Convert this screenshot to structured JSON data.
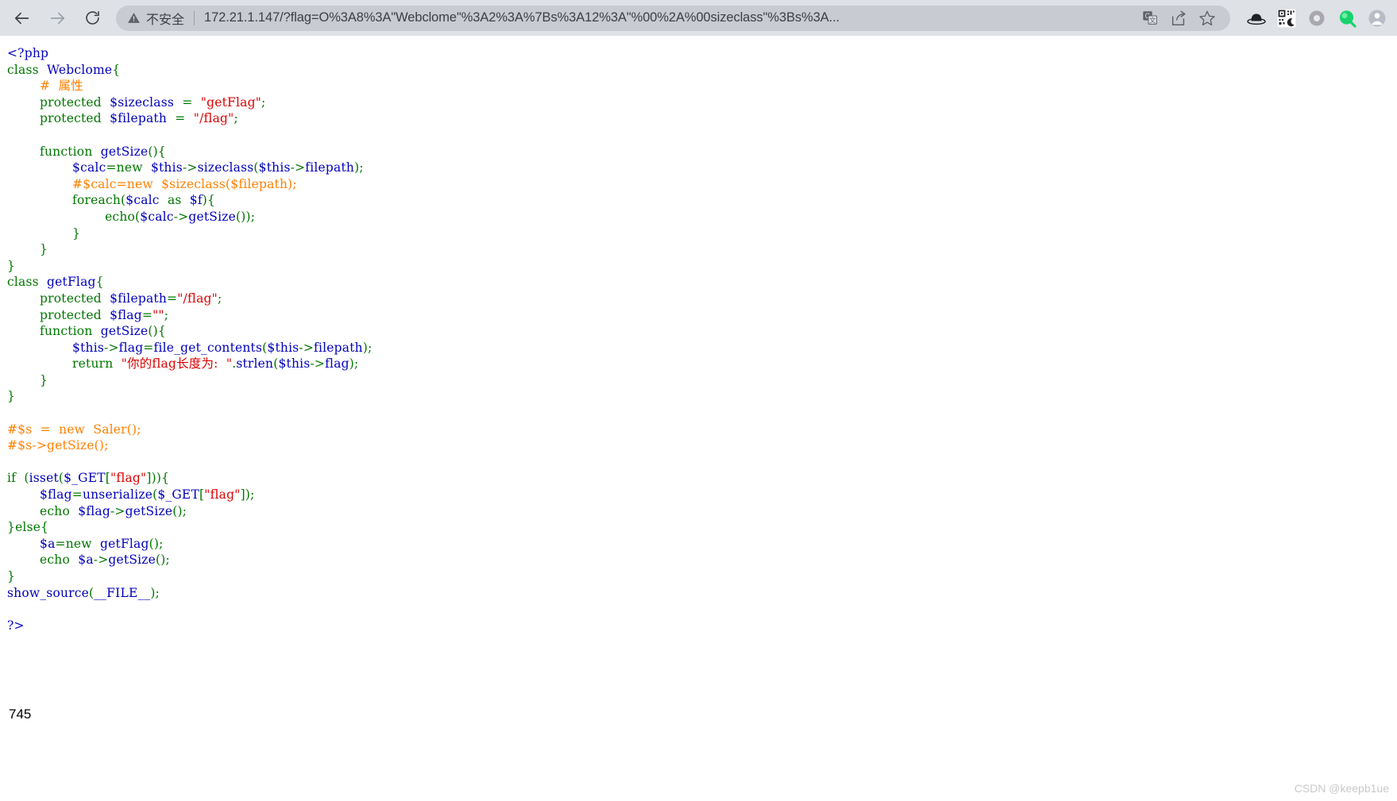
{
  "browser": {
    "back_label": "Back",
    "forward_label": "Forward",
    "reload_label": "Reload",
    "security_label": "不安全",
    "url": "172.21.1.147/?flag=O%3A8%3A\"Webclome\"%3A2%3A%7Bs%3A12%3A\"%00%2A%00sizeclass\"%3Bs%3A...",
    "omnibox_icons": [
      {
        "name": "translate-icon",
        "label": "Translate this page"
      },
      {
        "name": "share-icon",
        "label": "Share this page"
      },
      {
        "name": "bookmark-star-icon",
        "label": "Bookmark this tab"
      }
    ],
    "extension_icons": [
      {
        "name": "hat-extension-icon",
        "label": "Hat"
      },
      {
        "name": "qr-code-icon",
        "label": "QR code"
      },
      {
        "name": "ring-extension-icon",
        "label": "Extension"
      },
      {
        "name": "green-search-icon",
        "label": "Search extension"
      },
      {
        "name": "profile-avatar-icon",
        "label": "Profile"
      }
    ]
  },
  "page": {
    "php_output": "745",
    "watermark": "CSDN @keepb1ue",
    "source_lines": [
      [
        {
          "t": "<?php",
          "c": "c-default"
        }
      ],
      [
        {
          "t": "class  ",
          "c": "c-kw"
        },
        {
          "t": "Webclome",
          "c": "c-default"
        },
        {
          "t": "{",
          "c": "c-kw"
        }
      ],
      [
        {
          "t": "        ",
          "c": "c-default"
        },
        {
          "t": "#  属性",
          "c": "c-com"
        }
      ],
      [
        {
          "t": "        ",
          "c": "c-default"
        },
        {
          "t": "protected  ",
          "c": "c-kw"
        },
        {
          "t": "$sizeclass",
          "c": "c-var"
        },
        {
          "t": "  =  ",
          "c": "c-kw"
        },
        {
          "t": "\"getFlag\"",
          "c": "c-str"
        },
        {
          "t": ";",
          "c": "c-kw"
        }
      ],
      [
        {
          "t": "        ",
          "c": "c-default"
        },
        {
          "t": "protected  ",
          "c": "c-kw"
        },
        {
          "t": "$filepath",
          "c": "c-var"
        },
        {
          "t": "  =  ",
          "c": "c-kw"
        },
        {
          "t": "\"/flag\"",
          "c": "c-str"
        },
        {
          "t": ";",
          "c": "c-kw"
        }
      ],
      [
        {
          "t": "",
          "c": "c-default"
        }
      ],
      [
        {
          "t": "        ",
          "c": "c-default"
        },
        {
          "t": "function  ",
          "c": "c-kw"
        },
        {
          "t": "getSize",
          "c": "c-default"
        },
        {
          "t": "(){",
          "c": "c-kw"
        }
      ],
      [
        {
          "t": "                ",
          "c": "c-default"
        },
        {
          "t": "$calc",
          "c": "c-var"
        },
        {
          "t": "=",
          "c": "c-kw"
        },
        {
          "t": "new  ",
          "c": "c-kw"
        },
        {
          "t": "$this",
          "c": "c-var"
        },
        {
          "t": "->",
          "c": "c-kw"
        },
        {
          "t": "sizeclass",
          "c": "c-default"
        },
        {
          "t": "(",
          "c": "c-kw"
        },
        {
          "t": "$this",
          "c": "c-var"
        },
        {
          "t": "->",
          "c": "c-kw"
        },
        {
          "t": "filepath",
          "c": "c-default"
        },
        {
          "t": ");",
          "c": "c-kw"
        }
      ],
      [
        {
          "t": "                ",
          "c": "c-default"
        },
        {
          "t": "#$calc=new  $sizeclass($filepath);",
          "c": "c-com"
        }
      ],
      [
        {
          "t": "                ",
          "c": "c-default"
        },
        {
          "t": "foreach",
          "c": "c-kw"
        },
        {
          "t": "(",
          "c": "c-kw"
        },
        {
          "t": "$calc",
          "c": "c-var"
        },
        {
          "t": "  as  ",
          "c": "c-kw"
        },
        {
          "t": "$f",
          "c": "c-var"
        },
        {
          "t": "){",
          "c": "c-kw"
        }
      ],
      [
        {
          "t": "                        ",
          "c": "c-default"
        },
        {
          "t": "echo",
          "c": "c-kw"
        },
        {
          "t": "(",
          "c": "c-kw"
        },
        {
          "t": "$calc",
          "c": "c-var"
        },
        {
          "t": "->",
          "c": "c-kw"
        },
        {
          "t": "getSize",
          "c": "c-default"
        },
        {
          "t": "());",
          "c": "c-kw"
        }
      ],
      [
        {
          "t": "                ",
          "c": "c-default"
        },
        {
          "t": "}",
          "c": "c-kw"
        }
      ],
      [
        {
          "t": "        ",
          "c": "c-default"
        },
        {
          "t": "}",
          "c": "c-kw"
        }
      ],
      [
        {
          "t": "}",
          "c": "c-kw"
        }
      ],
      [
        {
          "t": "class  ",
          "c": "c-kw"
        },
        {
          "t": "getFlag",
          "c": "c-default"
        },
        {
          "t": "{",
          "c": "c-kw"
        }
      ],
      [
        {
          "t": "        ",
          "c": "c-default"
        },
        {
          "t": "protected  ",
          "c": "c-kw"
        },
        {
          "t": "$filepath",
          "c": "c-var"
        },
        {
          "t": "=",
          "c": "c-kw"
        },
        {
          "t": "\"/flag\"",
          "c": "c-str"
        },
        {
          "t": ";",
          "c": "c-kw"
        }
      ],
      [
        {
          "t": "        ",
          "c": "c-default"
        },
        {
          "t": "protected  ",
          "c": "c-kw"
        },
        {
          "t": "$flag",
          "c": "c-var"
        },
        {
          "t": "=",
          "c": "c-kw"
        },
        {
          "t": "\"\"",
          "c": "c-str"
        },
        {
          "t": ";",
          "c": "c-kw"
        }
      ],
      [
        {
          "t": "        ",
          "c": "c-default"
        },
        {
          "t": "function  ",
          "c": "c-kw"
        },
        {
          "t": "getSize",
          "c": "c-default"
        },
        {
          "t": "(){",
          "c": "c-kw"
        }
      ],
      [
        {
          "t": "                ",
          "c": "c-default"
        },
        {
          "t": "$this",
          "c": "c-var"
        },
        {
          "t": "->",
          "c": "c-kw"
        },
        {
          "t": "flag",
          "c": "c-default"
        },
        {
          "t": "=",
          "c": "c-kw"
        },
        {
          "t": "file_get_contents",
          "c": "c-default"
        },
        {
          "t": "(",
          "c": "c-kw"
        },
        {
          "t": "$this",
          "c": "c-var"
        },
        {
          "t": "->",
          "c": "c-kw"
        },
        {
          "t": "filepath",
          "c": "c-default"
        },
        {
          "t": ");",
          "c": "c-kw"
        }
      ],
      [
        {
          "t": "                ",
          "c": "c-default"
        },
        {
          "t": "return  ",
          "c": "c-kw"
        },
        {
          "t": "\"你的flag长度为:  \"",
          "c": "c-str"
        },
        {
          "t": ".",
          "c": "c-kw"
        },
        {
          "t": "strlen",
          "c": "c-default"
        },
        {
          "t": "(",
          "c": "c-kw"
        },
        {
          "t": "$this",
          "c": "c-var"
        },
        {
          "t": "->",
          "c": "c-kw"
        },
        {
          "t": "flag",
          "c": "c-default"
        },
        {
          "t": ");",
          "c": "c-kw"
        }
      ],
      [
        {
          "t": "        ",
          "c": "c-default"
        },
        {
          "t": "}",
          "c": "c-kw"
        }
      ],
      [
        {
          "t": "}",
          "c": "c-kw"
        }
      ],
      [
        {
          "t": "",
          "c": "c-default"
        }
      ],
      [
        {
          "t": "#$s  =  new  Saler();",
          "c": "c-com"
        }
      ],
      [
        {
          "t": "#$s->getSize();",
          "c": "c-com"
        }
      ],
      [
        {
          "t": "",
          "c": "c-default"
        }
      ],
      [
        {
          "t": "if  ",
          "c": "c-kw"
        },
        {
          "t": "(",
          "c": "c-kw"
        },
        {
          "t": "isset",
          "c": "c-default"
        },
        {
          "t": "(",
          "c": "c-kw"
        },
        {
          "t": "$_GET",
          "c": "c-var"
        },
        {
          "t": "[",
          "c": "c-kw"
        },
        {
          "t": "\"flag\"",
          "c": "c-str"
        },
        {
          "t": "])){",
          "c": "c-kw"
        }
      ],
      [
        {
          "t": "        ",
          "c": "c-default"
        },
        {
          "t": "$flag",
          "c": "c-var"
        },
        {
          "t": "=",
          "c": "c-kw"
        },
        {
          "t": "unserialize",
          "c": "c-default"
        },
        {
          "t": "(",
          "c": "c-kw"
        },
        {
          "t": "$_GET",
          "c": "c-var"
        },
        {
          "t": "[",
          "c": "c-kw"
        },
        {
          "t": "\"flag\"",
          "c": "c-str"
        },
        {
          "t": "]);",
          "c": "c-kw"
        }
      ],
      [
        {
          "t": "        ",
          "c": "c-default"
        },
        {
          "t": "echo  ",
          "c": "c-kw"
        },
        {
          "t": "$flag",
          "c": "c-var"
        },
        {
          "t": "->",
          "c": "c-kw"
        },
        {
          "t": "getSize",
          "c": "c-default"
        },
        {
          "t": "();",
          "c": "c-kw"
        }
      ],
      [
        {
          "t": "}",
          "c": "c-kw"
        },
        {
          "t": "else",
          "c": "c-kw"
        },
        {
          "t": "{",
          "c": "c-kw"
        }
      ],
      [
        {
          "t": "        ",
          "c": "c-default"
        },
        {
          "t": "$a",
          "c": "c-var"
        },
        {
          "t": "=",
          "c": "c-kw"
        },
        {
          "t": "new  ",
          "c": "c-kw"
        },
        {
          "t": "getFlag",
          "c": "c-default"
        },
        {
          "t": "();",
          "c": "c-kw"
        }
      ],
      [
        {
          "t": "        ",
          "c": "c-default"
        },
        {
          "t": "echo  ",
          "c": "c-kw"
        },
        {
          "t": "$a",
          "c": "c-var"
        },
        {
          "t": "->",
          "c": "c-kw"
        },
        {
          "t": "getSize",
          "c": "c-default"
        },
        {
          "t": "();",
          "c": "c-kw"
        }
      ],
      [
        {
          "t": "}",
          "c": "c-kw"
        }
      ],
      [
        {
          "t": "show_source",
          "c": "c-default"
        },
        {
          "t": "(",
          "c": "c-kw"
        },
        {
          "t": "__FILE__",
          "c": "c-default"
        },
        {
          "t": ");",
          "c": "c-kw"
        }
      ],
      [
        {
          "t": "",
          "c": "c-default"
        }
      ],
      [
        {
          "t": "?>",
          "c": "c-default"
        }
      ]
    ]
  }
}
